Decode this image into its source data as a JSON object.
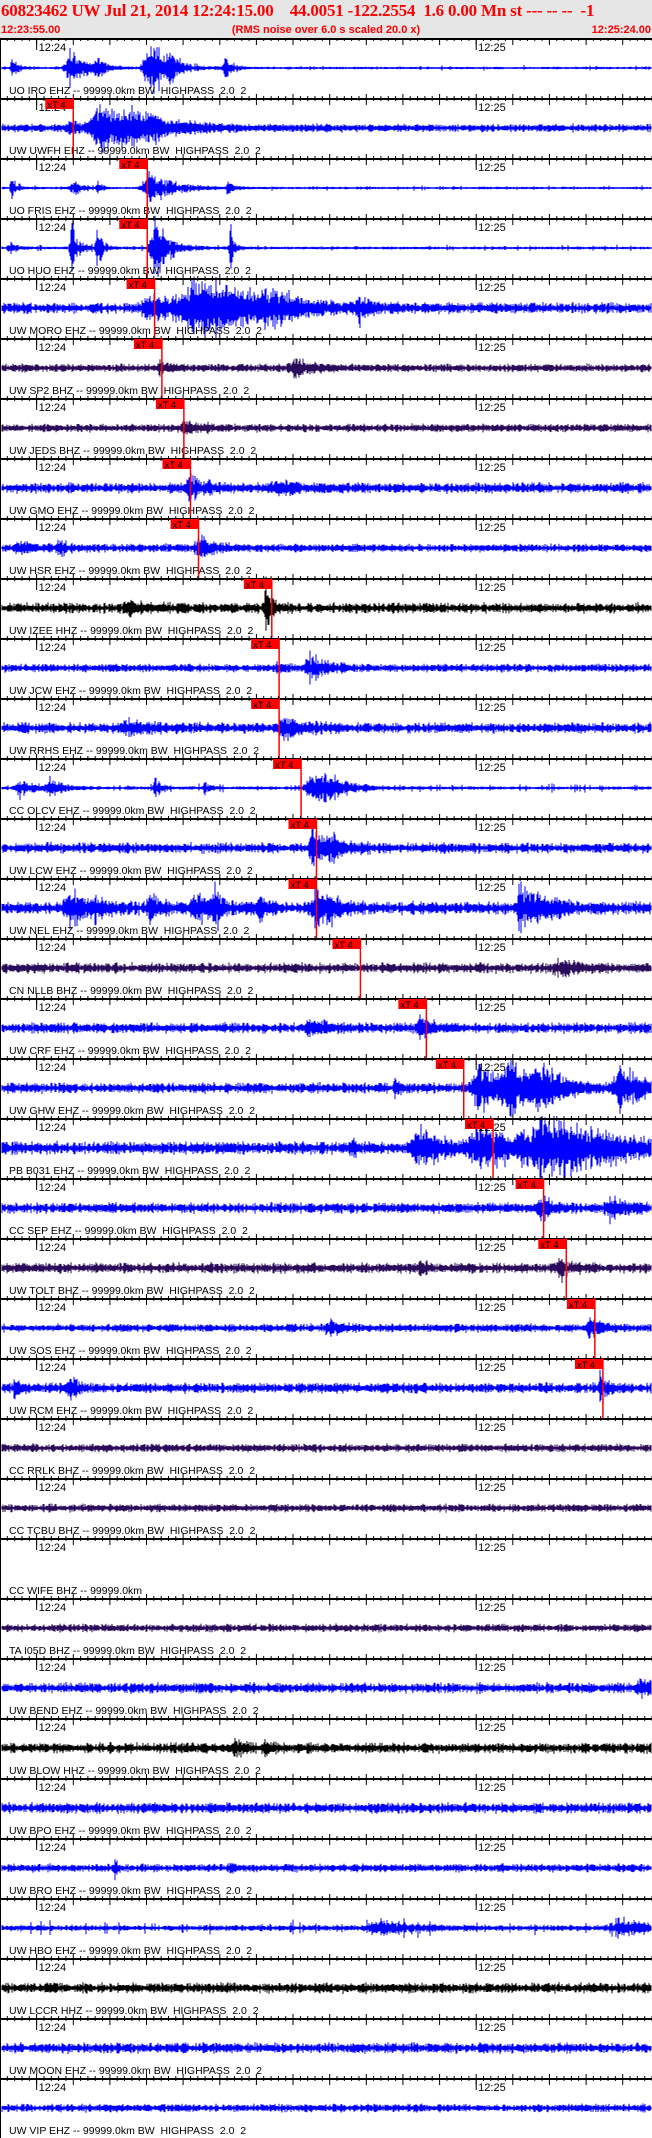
{
  "header": {
    "title": "60823462 UW Jul 21, 2014 12:24:15.00    44.0051 -122.2554  1.6 0.00 Mn st --- -- --  -1",
    "start_time": "12:23:55.00",
    "rms_note": "(RMS noise over 6.0 s scaled 20.0 x)",
    "end_time": "12:25:24.00"
  },
  "chart_data": {
    "type": "line",
    "time_axis": {
      "start": "12:23:55",
      "end": "12:25:24",
      "tick_labels": [
        "12:24",
        "12:25"
      ],
      "major_tick_seconds": 5,
      "minor_tick_seconds": 1
    },
    "colors": {
      "EHZ": "#0000ff",
      "BHZ": "#2a0a5a",
      "HHZ": "#000000",
      "pick": "#ff0000"
    },
    "traces": [
      {
        "label": "UO IRO EHZ -- 99999.0km BW  HIGHPASS  2.0  2",
        "comp": "EHZ"
      },
      {
        "label": "UW UWFH EHZ -- 99999.0km BW  HIGHPASS  2.0  2",
        "comp": "EHZ",
        "pick": {
          "label": "xT 4",
          "time": "12:24:05.0"
        }
      },
      {
        "label": "UO FRIS EHZ -- 99999.0km BW  HIGHPASS  2.0  2",
        "comp": "EHZ",
        "pick": {
          "label": "xT 4",
          "time": "12:24:15.1"
        }
      },
      {
        "label": "UO HUO EHZ -- 99999.0km BW  HIGHPASS  2.0  2",
        "comp": "EHZ",
        "pick": {
          "label": "xT 4",
          "time": "12:24:15.1"
        }
      },
      {
        "label": "UW MORO EHZ -- 99999.0km BW  HIGHPASS  2.0  2",
        "comp": "EHZ",
        "pick": {
          "label": "xT 4",
          "time": "12:24:16.1"
        }
      },
      {
        "label": "UW SP2 BHZ -- 99999.0km BW  HIGHPASS  2.0  2",
        "comp": "BHZ",
        "pick": {
          "label": "xT 4",
          "time": "12:24:17.1"
        }
      },
      {
        "label": "UW JEDS BHZ -- 99999.0km BW  HIGHPASS  2.0  2",
        "comp": "BHZ",
        "pick": {
          "label": "xT 4",
          "time": "12:24:20.1"
        }
      },
      {
        "label": "UW GMO EHZ -- 99999.0km BW  HIGHPASS  2.0  2",
        "comp": "EHZ",
        "pick": {
          "label": "xT 4",
          "time": "12:24:21.0"
        }
      },
      {
        "label": "UW HSR EHZ -- 99999.0km BW  HIGHPASS  2.0  2",
        "comp": "EHZ",
        "pick": {
          "label": "xT 4",
          "time": "12:24:22.1"
        }
      },
      {
        "label": "UW IZEE HHZ -- 99999.0km BW  HIGHPASS  2.0  2",
        "comp": "HHZ",
        "pick": {
          "label": "xT 4",
          "time": "12:24:32.1"
        }
      },
      {
        "label": "UW JCW EHZ -- 99999.0km BW  HIGHPASS  2.0  2",
        "comp": "EHZ",
        "pick": {
          "label": "xT 4",
          "time": "12:24:33.1"
        }
      },
      {
        "label": "UW RRHS EHZ -- 99999.0km BW  HIGHPASS  2.0  2",
        "comp": "EHZ",
        "pick": {
          "label": "xT 4",
          "time": "12:24:33.1"
        }
      },
      {
        "label": "CC OLCV EHZ -- 99999.0km BW  HIGHPASS  2.0  2",
        "comp": "EHZ",
        "pick": {
          "label": "xT 4",
          "time": "12:24:36.1"
        }
      },
      {
        "label": "UW LCW EHZ -- 99999.0km BW  HIGHPASS  2.0  2",
        "comp": "EHZ",
        "pick": {
          "label": "xT 4",
          "time": "12:24:38.2"
        }
      },
      {
        "label": "UW NEL EHZ -- 99999.0km BW  HIGHPASS  2.0  2",
        "comp": "EHZ",
        "pick": {
          "label": "xT 4",
          "time": "12:24:38.2"
        }
      },
      {
        "label": "CN NLLB BHZ -- 99999.0km BW  HIGHPASS  2.0  2",
        "comp": "BHZ",
        "pick": {
          "label": "xT 4",
          "time": "12:24:44.2"
        }
      },
      {
        "label": "UW CRF EHZ -- 99999.0km BW  HIGHPASS  2.0  2",
        "comp": "EHZ",
        "pick": {
          "label": "xT 4",
          "time": "12:24:53.2"
        }
      },
      {
        "label": "UW GHW EHZ -- 99999.0km BW  HIGHPASS  2.0  2",
        "comp": "EHZ",
        "pick": {
          "label": "xT 4",
          "time": "12:24:58.3"
        }
      },
      {
        "label": "PB B031 EHZ -- 99999.0km BW  HIGHPASS  2.0  2",
        "comp": "EHZ",
        "pick": {
          "label": "xT 4",
          "time": "12:25:02.3"
        }
      },
      {
        "label": "CC SEP EHZ -- 99999.0km BW  HIGHPASS  2.0  2",
        "comp": "EHZ",
        "pick": {
          "label": "xT 4",
          "time": "12:25:09.2"
        }
      },
      {
        "label": "UW TOLT BHZ -- 99999.0km BW  HIGHPASS  2.0  2",
        "comp": "BHZ",
        "pick": {
          "label": "xT 4",
          "time": "12:25:12.3"
        }
      },
      {
        "label": "UW SOS EHZ -- 99999.0km BW  HIGHPASS  2.0  2",
        "comp": "EHZ",
        "pick": {
          "label": "xT 4",
          "time": "12:25:16.2"
        }
      },
      {
        "label": "UW RCM EHZ -- 99999.0km BW  HIGHPASS  2.0  2",
        "comp": "EHZ",
        "pick": {
          "label": "xT 4",
          "time": "12:25:17.3"
        }
      },
      {
        "label": "CC RRLK BHZ -- 99999.0km BW  HIGHPASS  2.0  2",
        "comp": "BHZ"
      },
      {
        "label": "CC TCBU BHZ -- 99999.0km BW  HIGHPASS  2.0  2",
        "comp": "BHZ"
      },
      {
        "label": "CC WIFE BHZ -- 99999.0km",
        "comp": "BHZ",
        "empty": true
      },
      {
        "label": "TA I05D BHZ -- 99999.0km BW  HIGHPASS  2.0  2",
        "comp": "BHZ"
      },
      {
        "label": "UW BEND EHZ -- 99999.0km BW  HIGHPASS  2.0  2",
        "comp": "EHZ"
      },
      {
        "label": "UW BLOW HHZ -- 99999.0km BW  HIGHPASS  2.0  2",
        "comp": "HHZ"
      },
      {
        "label": "UW BPO EHZ -- 99999.0km BW  HIGHPASS  2.0  2",
        "comp": "EHZ"
      },
      {
        "label": "UW BRO EHZ -- 99999.0km BW  HIGHPASS  2.0  2",
        "comp": "EHZ"
      },
      {
        "label": "UW HBO EHZ -- 99999.0km BW  HIGHPASS  2.0  2",
        "comp": "EHZ"
      },
      {
        "label": "UW LCCR HHZ -- 99999.0km BW  HIGHPASS  2.0  2",
        "comp": "HHZ"
      },
      {
        "label": "UW MOON EHZ -- 99999.0km BW  HIGHPASS  2.0  2",
        "comp": "EHZ"
      },
      {
        "label": "UW VIP EHZ -- 99999.0km BW  HIGHPASS  2.0  2",
        "comp": "EHZ"
      }
    ]
  }
}
